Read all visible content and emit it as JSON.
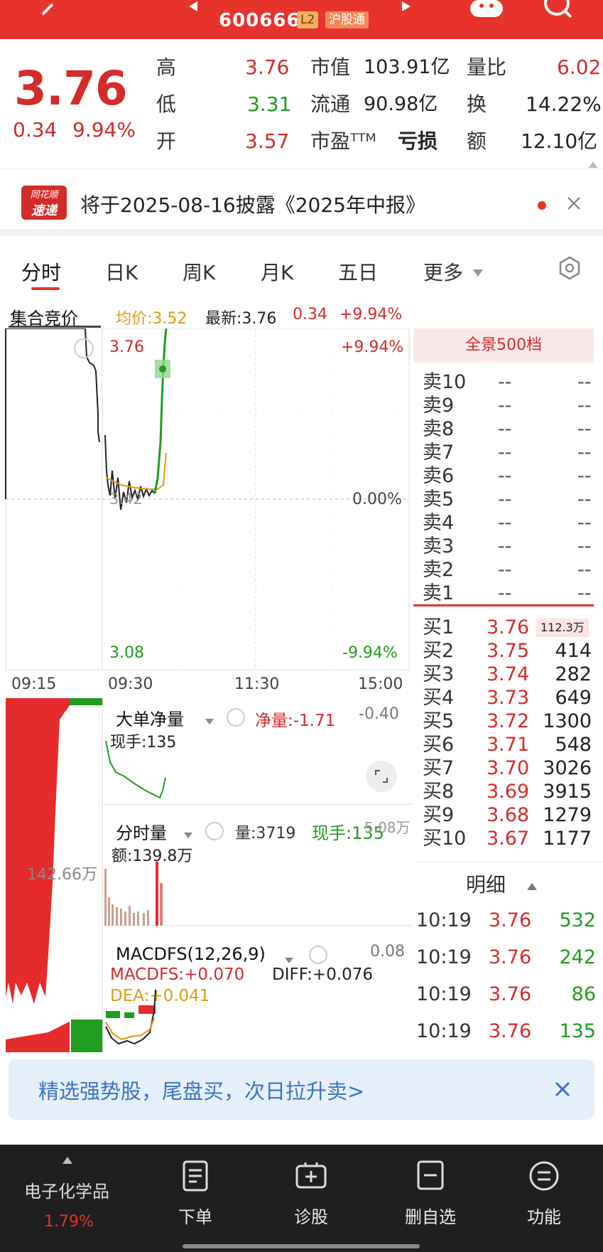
{
  "header": {
    "stock_code": "600666",
    "level_tag": "L2",
    "connect_tag": "沪股通"
  },
  "quote": {
    "price": "3.76",
    "change": "0.34",
    "change_pct": "9.94%",
    "high_label": "高",
    "high": "3.76",
    "low_label": "低",
    "low": "3.31",
    "open_label": "开",
    "open": "3.57",
    "mktcap_label": "市值",
    "mktcap": "103.91亿",
    "float_label": "流通",
    "float": "90.98亿",
    "pe_label": "市盈ᵀᵀᴹ",
    "pe": "亏损",
    "vol_ratio_label": "量比",
    "vol_ratio": "6.02",
    "turnover_label": "换",
    "turnover": "14.22%",
    "amount_label": "额",
    "amount": "12.10亿"
  },
  "notice": {
    "badge_top": "同花顺",
    "badge_bottom": "速递",
    "text": "将于2025-08-16披露《2025年中报》"
  },
  "tabs": [
    "分时",
    "日K",
    "周K",
    "月K",
    "五日",
    "更多"
  ],
  "info_bar": {
    "auction": "集合竞价",
    "avg": "均价:3.52",
    "latest": "最新:3.76",
    "chg": "0.34",
    "pct": "+9.94%"
  },
  "chart": {
    "price_top": "3.76",
    "pct_top": "+9.94%",
    "price_mid": "3.42",
    "pct_mid": "0.00%",
    "price_bottom": "3.08",
    "pct_bottom": "-9.94%",
    "times": [
      "09:15",
      "09:30",
      "11:30",
      "15:00"
    ],
    "left_label": "142.66万"
  },
  "indicators": {
    "big_net_title": "大单净量",
    "big_net_value": "净量:-1.71",
    "big_net_right": "-0.40",
    "big_net_hand": "现手:135",
    "vol_title": "分时量",
    "vol_value": "量:3719",
    "vol_hand": "现手:135",
    "vol_right": "5.08万",
    "vol_amount": "额:139.8万",
    "macd_title": "MACDFS(12,26,9)",
    "macd_right": "0.08",
    "macd_value": "MACDFS:+0.070",
    "diff_value": "DIFF:+0.076",
    "dea_value": "DEA:+0.041"
  },
  "orderbook": {
    "title": "全景500档",
    "sells": [
      {
        "label": "卖10",
        "price": "--",
        "vol": "--"
      },
      {
        "label": "卖9",
        "price": "--",
        "vol": "--"
      },
      {
        "label": "卖8",
        "price": "--",
        "vol": "--"
      },
      {
        "label": "卖7",
        "price": "--",
        "vol": "--"
      },
      {
        "label": "卖6",
        "price": "--",
        "vol": "--"
      },
      {
        "label": "卖5",
        "price": "--",
        "vol": "--"
      },
      {
        "label": "卖4",
        "price": "--",
        "vol": "--"
      },
      {
        "label": "卖3",
        "price": "--",
        "vol": "--"
      },
      {
        "label": "卖2",
        "price": "--",
        "vol": "--"
      },
      {
        "label": "卖1",
        "price": "--",
        "vol": "--"
      }
    ],
    "buys": [
      {
        "label": "买1",
        "price": "3.76",
        "vol": "112.3万"
      },
      {
        "label": "买2",
        "price": "3.75",
        "vol": "414"
      },
      {
        "label": "买3",
        "price": "3.74",
        "vol": "282"
      },
      {
        "label": "买4",
        "price": "3.73",
        "vol": "649"
      },
      {
        "label": "买5",
        "price": "3.72",
        "vol": "1300"
      },
      {
        "label": "买6",
        "price": "3.71",
        "vol": "548"
      },
      {
        "label": "买7",
        "price": "3.70",
        "vol": "3026"
      },
      {
        "label": "买8",
        "price": "3.69",
        "vol": "3915"
      },
      {
        "label": "买9",
        "price": "3.68",
        "vol": "1279"
      },
      {
        "label": "买10",
        "price": "3.67",
        "vol": "1177"
      }
    ]
  },
  "detail": {
    "title": "明细",
    "rows": [
      {
        "time": "10:19",
        "price": "3.76",
        "vol": "532"
      },
      {
        "time": "10:19",
        "price": "3.76",
        "vol": "242"
      },
      {
        "time": "10:19",
        "price": "3.76",
        "vol": "86"
      },
      {
        "time": "10:19",
        "price": "3.76",
        "vol": "135"
      }
    ]
  },
  "banner": {
    "text": "精选强势股，尾盘买，次日拉升卖>"
  },
  "bottom_nav": {
    "sector_name": "电子化学品",
    "sector_pct": "1.79%",
    "order": "下单",
    "diagnose": "诊股",
    "remove": "删自选",
    "func": "功能"
  }
}
